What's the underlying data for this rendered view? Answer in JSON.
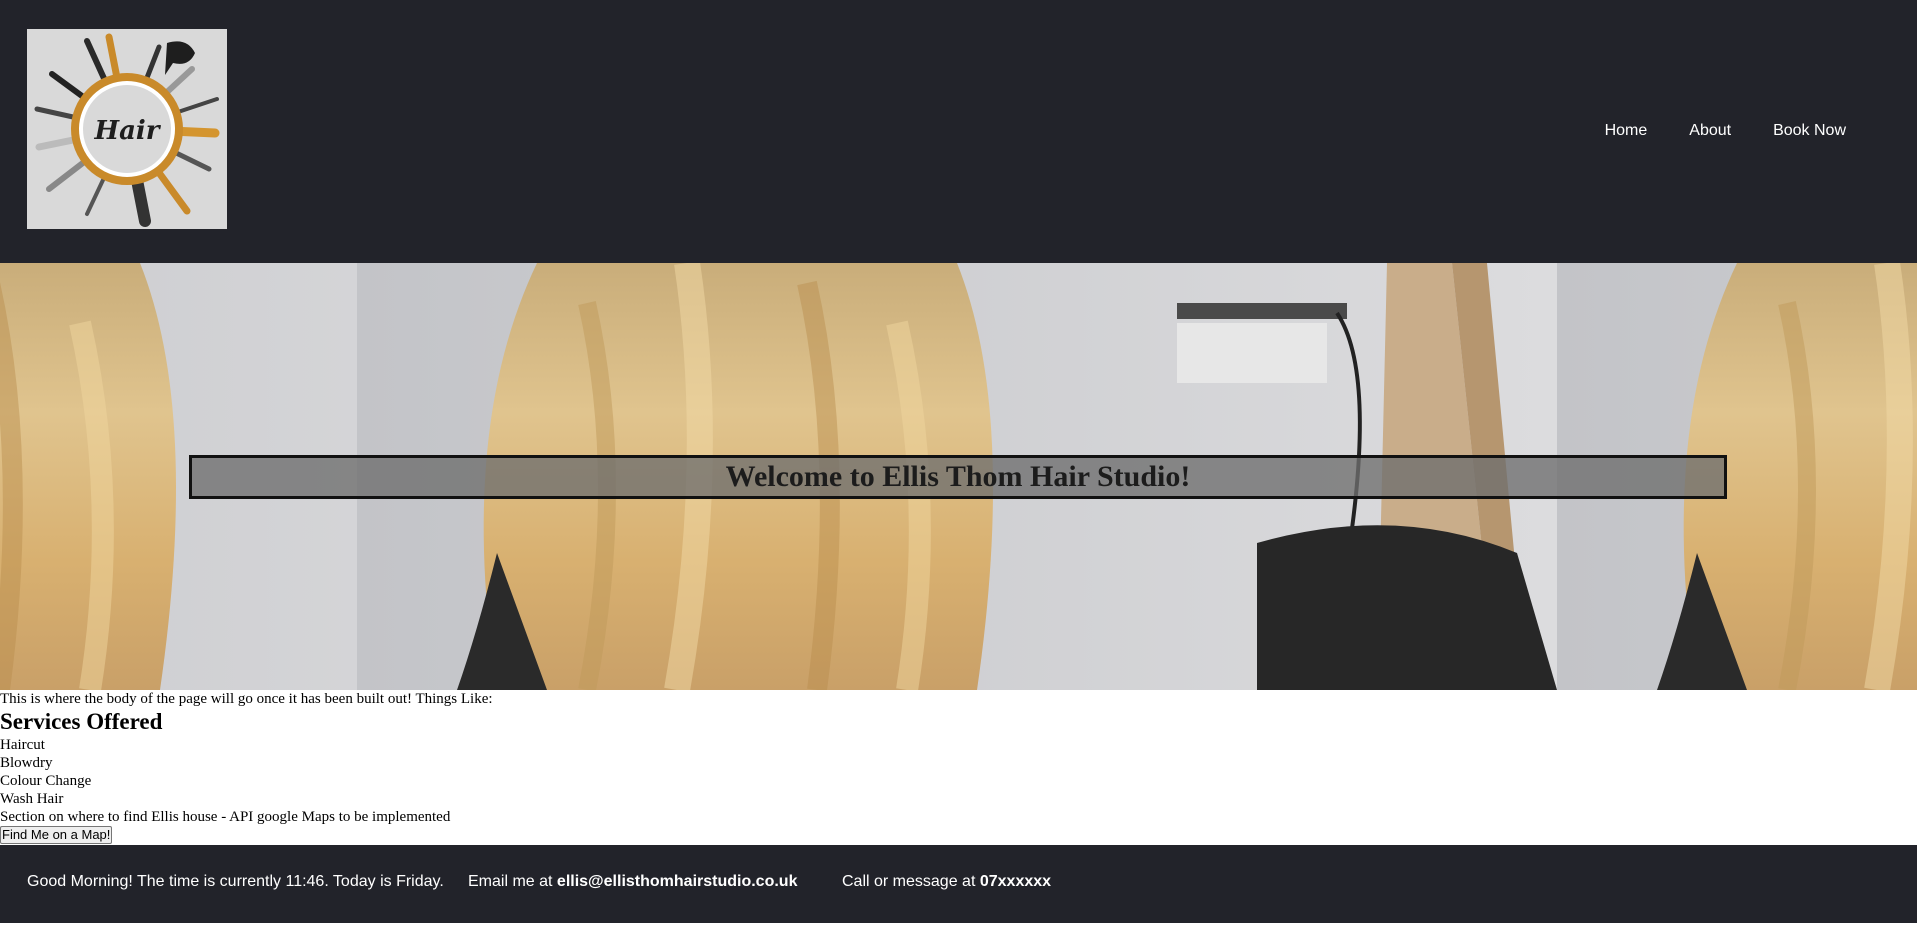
{
  "header": {
    "logo_text": "Hair",
    "nav": [
      {
        "label": "Home"
      },
      {
        "label": "About"
      },
      {
        "label": "Book Now"
      }
    ]
  },
  "hero": {
    "title": "Welcome to Ellis Thom Hair Studio!"
  },
  "body": {
    "intro": "This is where the body of the page will go once it has been built out! Things Like:",
    "services_heading": "Services Offered",
    "services": [
      "Haircut",
      "Blowdry",
      "Colour Change",
      "Wash Hair"
    ],
    "map_note": "Section on where to find Ellis house - API google Maps to be implemented",
    "map_button": "Find Me on a Map!"
  },
  "footer": {
    "greeting": "Good Morning! The time is currently 11:46. Today is Friday.",
    "email_prefix": "Email me at",
    "email": "ellis@ellisthomhairstudio.co.uk",
    "phone_prefix": "Call or message at",
    "phone": "07xxxxxx"
  },
  "colors": {
    "dark_bar": "#22232a",
    "text_light": "#ffffff"
  }
}
